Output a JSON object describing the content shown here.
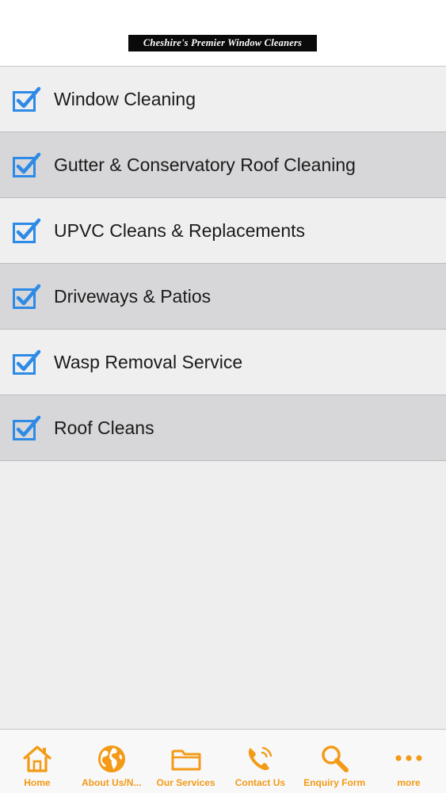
{
  "header": {
    "banner_text": "Cheshire's Premier Window Cleaners"
  },
  "colors": {
    "accent_orange": "#f39a16",
    "checkbox_blue": "#2d8ae6",
    "row_light": "#efeff0",
    "row_dark": "#d7d7d9"
  },
  "services": {
    "items": [
      {
        "label": "Window Cleaning",
        "checked": true
      },
      {
        "label": "Gutter & Conservatory Roof Cleaning",
        "checked": true
      },
      {
        "label": "UPVC Cleans & Replacements",
        "checked": true
      },
      {
        "label": "Driveways & Patios",
        "checked": true
      },
      {
        "label": "Wasp Removal Service",
        "checked": true
      },
      {
        "label": "Roof Cleans",
        "checked": true
      }
    ]
  },
  "tabbar": {
    "tabs": [
      {
        "label": "Home",
        "icon": "home-icon"
      },
      {
        "label": "About Us/N...",
        "icon": "globe-icon"
      },
      {
        "label": "Our Services",
        "icon": "folder-icon"
      },
      {
        "label": "Contact Us",
        "icon": "phone-icon"
      },
      {
        "label": "Enquiry Form",
        "icon": "search-icon"
      },
      {
        "label": "more",
        "icon": "more-icon"
      }
    ]
  }
}
